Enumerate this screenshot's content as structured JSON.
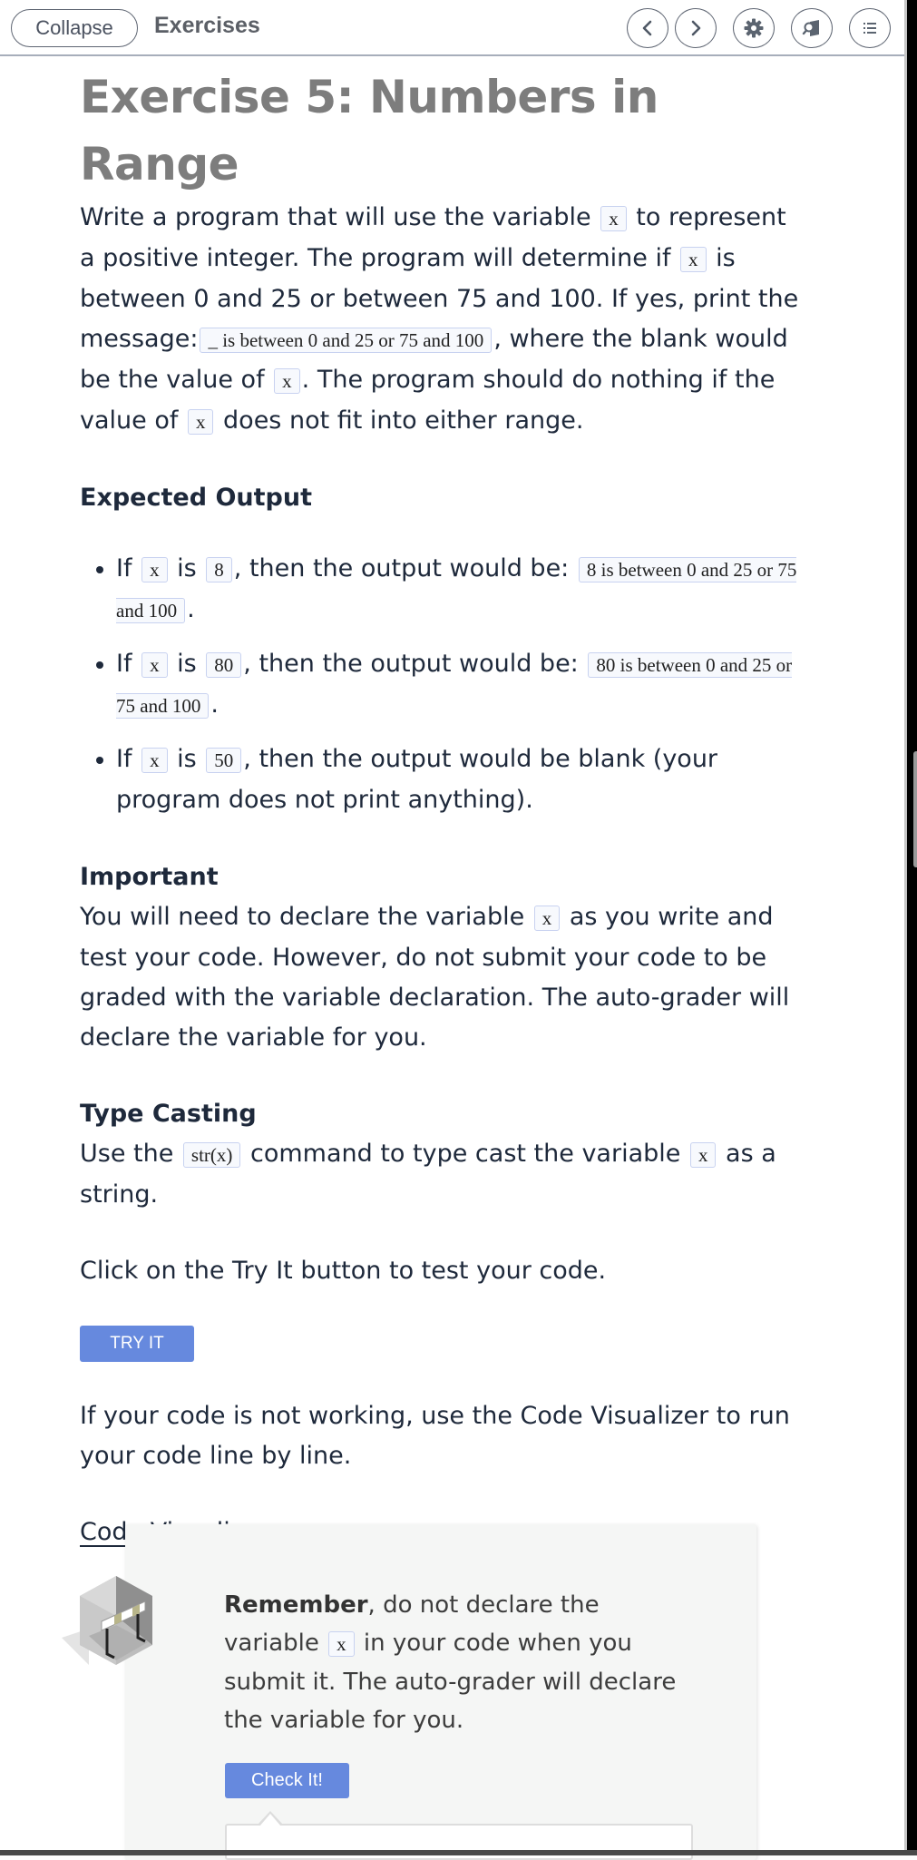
{
  "topbar": {
    "collapse_label": "Collapse",
    "title": "Exercises",
    "icons": [
      "chevron-left-icon",
      "chevron-right-icon",
      "gear-icon",
      "book-search-icon",
      "list-icon"
    ]
  },
  "exercise": {
    "title": "Exercise 5: Numbers in Range",
    "intro": {
      "t1": "Write a program that will use the variable ",
      "c1": "x",
      "t2": " to represent a positive integer. The program will determine if ",
      "c2": "x",
      "t3": " is between 0 and 25 or between 75 and 100. If yes, print the message:",
      "c3": "_ is between 0 and 25 or 75 and 100",
      "t4": ", where the blank would be the value of ",
      "c4": "x",
      "t5": ". The program should do nothing if the value of ",
      "c5": "x",
      "t6": " does not fit into either range."
    },
    "expected_output": {
      "heading": "Expected Output",
      "items": [
        {
          "if": "If ",
          "var": "x",
          "is": " is ",
          "value": "8",
          "then": ", then the output would be: ",
          "output": "8 is between 0 and 25 or 75 and 100",
          "end": "."
        },
        {
          "if": "If ",
          "var": "x",
          "is": " is ",
          "value": "80",
          "then": ", then the output would be: ",
          "output": "80 is between 0 and 25 or 75 and 100",
          "end": "."
        },
        {
          "if": "If ",
          "var": "x",
          "is": " is ",
          "value": "50",
          "then": ", then the output would be blank (your program does not print anything).",
          "output": "",
          "end": ""
        }
      ]
    },
    "important": {
      "heading": "Important",
      "t1": "You will need to declare the variable ",
      "c1": "x",
      "t2": " as you write and test your code. However, do not submit your code to be graded with the variable declaration. The auto-grader will declare the variable for you."
    },
    "type_casting": {
      "heading": "Type Casting",
      "t1": "Use the ",
      "c1": "str(x)",
      "t2": " command to type cast the variable ",
      "c2": "x",
      "t3": " as a string."
    },
    "try_instruction": "Click on the Try It button to test your code.",
    "try_button": "TRY IT",
    "visualizer_instruction": "If your code is not working, use the Code Visualizer to run your code line by line.",
    "visualizer_link": "Code Visualizer"
  },
  "remember": {
    "bold": "Remember",
    "t1": ", do not declare the variable ",
    "c1": "x",
    "t2": " in your code when you submit it. The auto-grader will declare the variable for you.",
    "check_button": "Check It!"
  },
  "colors": {
    "accent_button": "#6689de",
    "title_gray": "#7d7d7d",
    "code_border": "#c8d2f0"
  }
}
